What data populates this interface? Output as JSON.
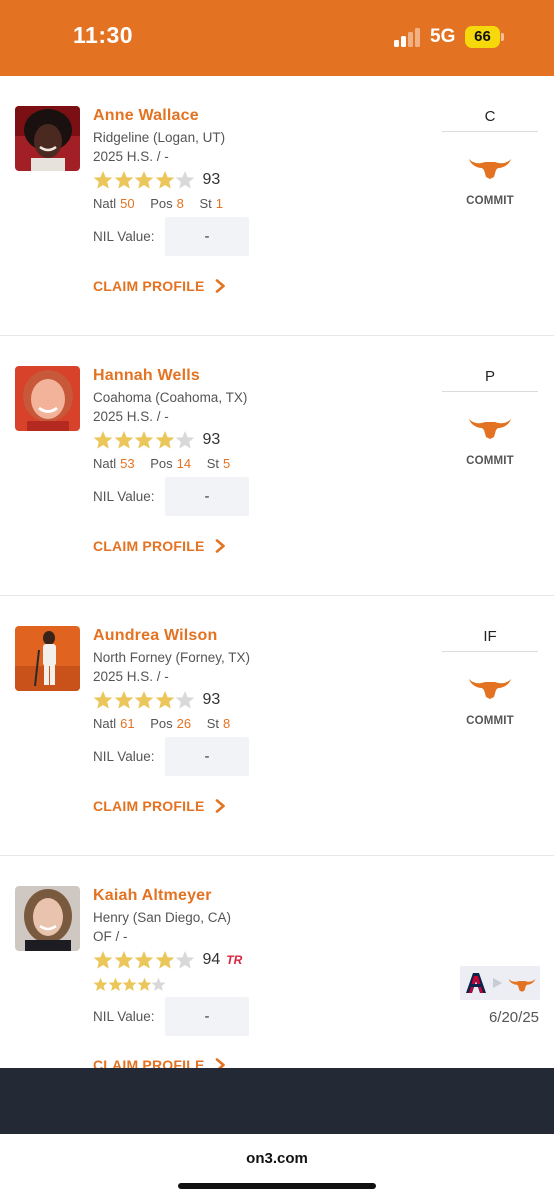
{
  "status_bar": {
    "time": "11:30",
    "network": "5G",
    "battery": "66",
    "background_color": "#E37322"
  },
  "players": [
    {
      "name": "Anne Wallace",
      "school": "Ridgeline (Logan, UT)",
      "class_line": "2025 H.S. / -",
      "stars": 4,
      "rating": "93",
      "ranks": {
        "natl_label": "Natl",
        "natl": "50",
        "pos_label": "Pos",
        "pos": "8",
        "st_label": "St",
        "st": "1"
      },
      "nil_label": "NIL Value:",
      "nil_value": "-",
      "claim_label": "CLAIM PROFILE",
      "position": "C",
      "status_label": "COMMIT",
      "status_icon": "longhorn-icon"
    },
    {
      "name": "Hannah Wells",
      "school": "Coahoma (Coahoma, TX)",
      "class_line": "2025 H.S. / -",
      "stars": 4,
      "rating": "93",
      "ranks": {
        "natl_label": "Natl",
        "natl": "53",
        "pos_label": "Pos",
        "pos": "14",
        "st_label": "St",
        "st": "5"
      },
      "nil_label": "NIL Value:",
      "nil_value": "-",
      "claim_label": "CLAIM PROFILE",
      "position": "P",
      "status_label": "COMMIT",
      "status_icon": "longhorn-icon"
    },
    {
      "name": "Aundrea Wilson",
      "school": "North Forney (Forney, TX)",
      "class_line": "2025 H.S. / -",
      "stars": 4,
      "rating": "93",
      "ranks": {
        "natl_label": "Natl",
        "natl": "61",
        "pos_label": "Pos",
        "pos": "26",
        "st_label": "St",
        "st": "8"
      },
      "nil_label": "NIL Value:",
      "nil_value": "-",
      "claim_label": "CLAIM PROFILE",
      "position": "IF",
      "status_label": "COMMIT",
      "status_icon": "longhorn-icon"
    },
    {
      "name": "Kaiah Altmeyer",
      "school": "Henry (San Diego, CA)",
      "class_line": "OF / -",
      "stars": 4,
      "rating": "94",
      "transfer_badge": "TR",
      "secondary_stars": 4,
      "nil_label": "NIL Value:",
      "nil_value": "-",
      "claim_label": "CLAIM PROFILE",
      "transfer_from_icon": "arizona-a-icon",
      "transfer_to_icon": "longhorn-icon",
      "transfer_date": "6/20/25"
    }
  ],
  "browser": {
    "url": "on3.com"
  },
  "colors": {
    "accent": "#E37322",
    "star_filled": "#EBC65A",
    "star_empty": "#D9D9D9",
    "arizona_navy": "#0C234B",
    "arizona_red": "#CC0033"
  }
}
